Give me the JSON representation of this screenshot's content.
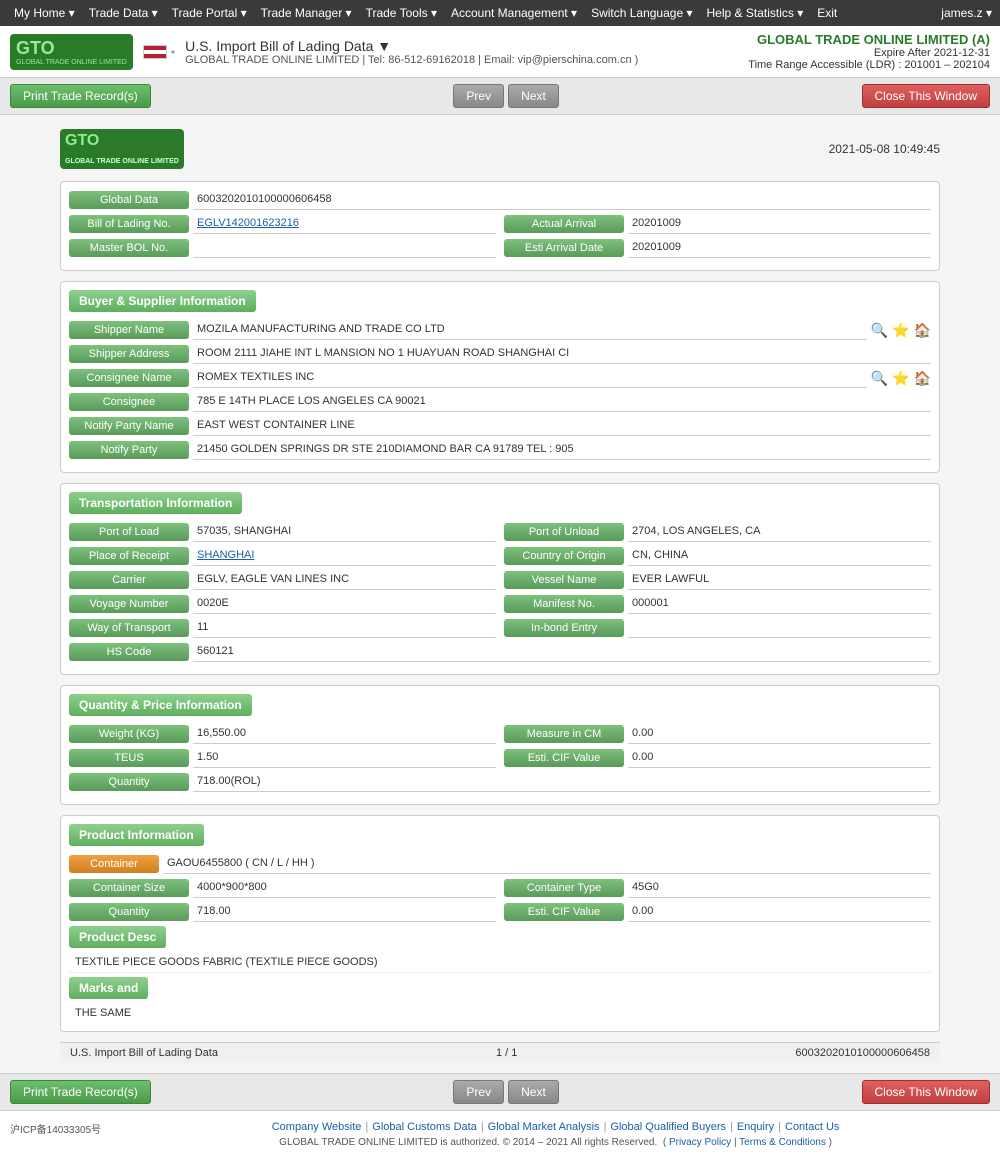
{
  "nav": {
    "items": [
      "My Home ▾",
      "Trade Data ▾",
      "Trade Portal ▾",
      "Trade Manager ▾",
      "Trade Tools ▾",
      "Account Management ▾",
      "Switch Language ▾",
      "Help & Statistics ▾",
      "Exit"
    ],
    "user": "james.z ▾"
  },
  "header": {
    "logo_text": "GTO",
    "logo_sub": "GLOBAL TRADE ONLINE LIMITED",
    "flag_alt": "US Flag",
    "title": "U.S. Import Bill of Lading Data ▼",
    "subtitle": "GLOBAL TRADE ONLINE LIMITED | Tel: 86-512-69162018 | Email: vip@pierschina.com.cn )",
    "brand": "GLOBAL TRADE ONLINE LIMITED (A)",
    "expire": "Expire After 2021-12-31",
    "time_range": "Time Range Accessible (LDR) : 201001 – 202104"
  },
  "toolbar": {
    "print_label": "Print Trade Record(s)",
    "prev_label": "Prev",
    "next_label": "Next",
    "close_label": "Close This Window"
  },
  "record": {
    "datetime": "2021-05-08 10:49:45",
    "global_data_label": "Global Data",
    "global_data_value": "6003202010100000606458",
    "bol_label": "Bill of Lading No.",
    "bol_value": "EGLV142001623216",
    "actual_arrival_label": "Actual Arrival",
    "actual_arrival_value": "20201009",
    "master_bol_label": "Master BOL No.",
    "master_bol_value": "",
    "esti_arrival_label": "Esti Arrival Date",
    "esti_arrival_value": "20201009"
  },
  "buyer_supplier": {
    "section_title": "Buyer & Supplier Information",
    "shipper_name_label": "Shipper Name",
    "shipper_name_value": "MOZILA MANUFACTURING AND TRADE CO LTD",
    "shipper_address_label": "Shipper Address",
    "shipper_address_value": "ROOM 2111 JIAHE INT L MANSION NO 1 HUAYUAN ROAD SHANGHAI CI",
    "consignee_name_label": "Consignee Name",
    "consignee_name_value": "ROMEX TEXTILES INC",
    "consignee_label": "Consignee",
    "consignee_value": "785 E 14TH PLACE LOS ANGELES CA 90021",
    "notify_party_name_label": "Notify Party Name",
    "notify_party_name_value": "EAST WEST CONTAINER LINE",
    "notify_party_label": "Notify Party",
    "notify_party_value": "21450 GOLDEN SPRINGS DR STE 210DIAMOND BAR CA 91789 TEL : 905"
  },
  "transportation": {
    "section_title": "Transportation Information",
    "port_of_load_label": "Port of Load",
    "port_of_load_value": "57035, SHANGHAI",
    "port_of_unload_label": "Port of Unload",
    "port_of_unload_value": "2704, LOS ANGELES, CA",
    "place_of_receipt_label": "Place of Receipt",
    "place_of_receipt_value": "SHANGHAI",
    "country_of_origin_label": "Country of Origin",
    "country_of_origin_value": "CN, CHINA",
    "carrier_label": "Carrier",
    "carrier_value": "EGLV, EAGLE VAN LINES INC",
    "vessel_name_label": "Vessel Name",
    "vessel_name_value": "EVER LAWFUL",
    "voyage_number_label": "Voyage Number",
    "voyage_number_value": "0020E",
    "manifest_no_label": "Manifest No.",
    "manifest_no_value": "000001",
    "way_of_transport_label": "Way of Transport",
    "way_of_transport_value": "11",
    "in_bond_entry_label": "In-bond Entry",
    "in_bond_entry_value": "",
    "hs_code_label": "HS Code",
    "hs_code_value": "560121"
  },
  "quantity_price": {
    "section_title": "Quantity & Price Information",
    "weight_label": "Weight (KG)",
    "weight_value": "16,550.00",
    "measure_in_cm_label": "Measure in CM",
    "measure_in_cm_value": "0.00",
    "teus_label": "TEUS",
    "teus_value": "1.50",
    "esti_cif_label": "Esti. CIF Value",
    "esti_cif_value": "0.00",
    "quantity_label": "Quantity",
    "quantity_value": "718.00(ROL)"
  },
  "product": {
    "section_title": "Product Information",
    "container_label": "Container",
    "container_value": "GAOU6455800 ( CN / L / HH )",
    "container_size_label": "Container Size",
    "container_size_value": "4000*900*800",
    "container_type_label": "Container Type",
    "container_type_value": "45G0",
    "quantity_label": "Quantity",
    "quantity_value": "718.00",
    "esti_cif_label": "Esti. CIF Value",
    "esti_cif_value": "0.00",
    "product_desc_label": "Product Desc",
    "product_desc_value": "TEXTILE PIECE GOODS FABRIC (TEXTILE PIECE GOODS)",
    "marks_label": "Marks and",
    "marks_value": "THE SAME"
  },
  "pagination": {
    "record_type": "U.S. Import Bill of Lading Data",
    "page_info": "1 / 1",
    "record_id": "6003202010100000606458"
  },
  "footer": {
    "icp": "沪ICP备14033305号",
    "links": [
      "Company Website",
      "Global Customs Data",
      "Global Market Analysis",
      "Global Qualified Buyers",
      "Enquiry",
      "Contact Us"
    ],
    "copyright": "GLOBAL TRADE ONLINE LIMITED is authorized. © 2014 – 2021 All rights Reserved.",
    "privacy": "Privacy Policy",
    "terms": "Terms & Conditions"
  }
}
